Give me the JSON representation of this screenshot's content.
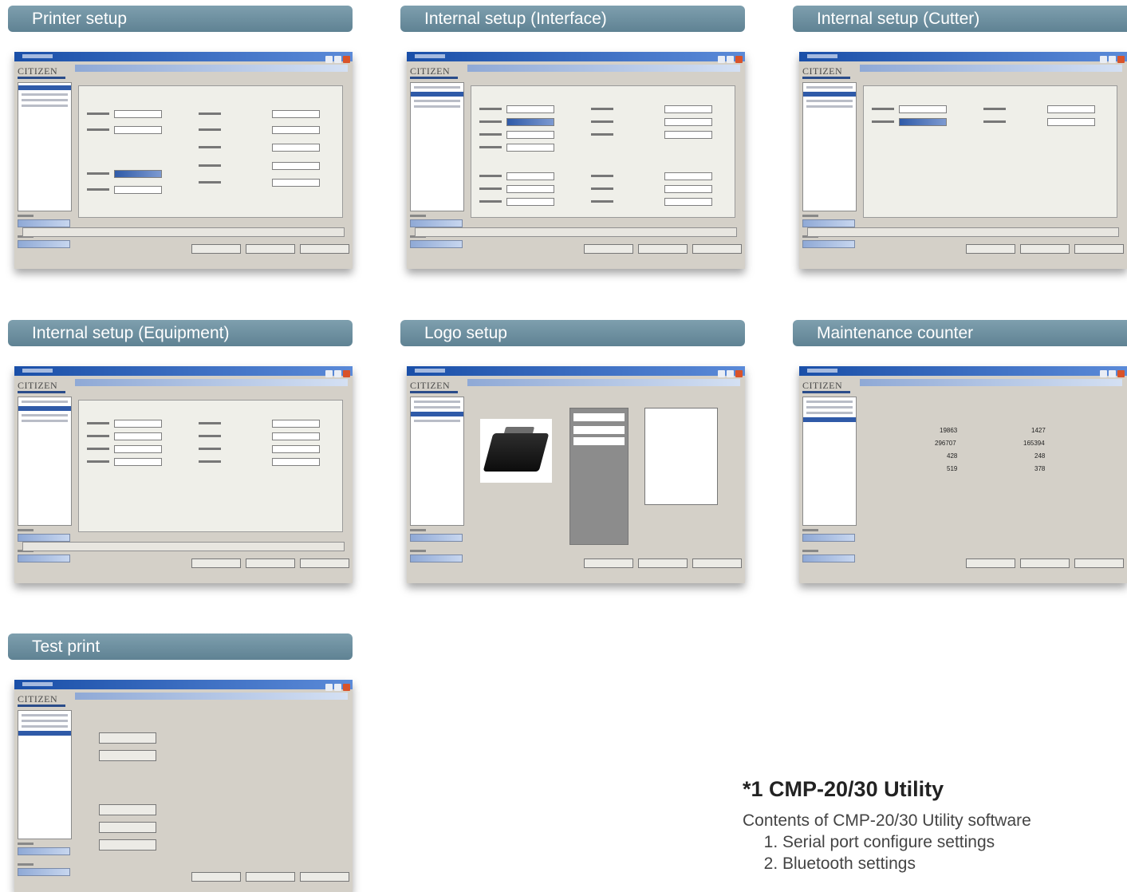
{
  "panels": [
    {
      "title": "Printer setup"
    },
    {
      "title": "Internal setup (Interface)"
    },
    {
      "title": "Internal setup (Cutter)"
    },
    {
      "title": "Internal setup (Equipment)"
    },
    {
      "title": "Logo setup"
    },
    {
      "title": "Maintenance counter"
    },
    {
      "title": "Test print"
    }
  ],
  "screenshot_logo": "CITIZEN",
  "maintenance": {
    "col1": [
      "19863",
      "296707",
      "428",
      "519"
    ],
    "col2": [
      "1427",
      "165394",
      "248",
      "378"
    ]
  },
  "note": {
    "heading": "*1 CMP-20/30 Utility",
    "subtitle": "Contents of CMP-20/30 Utility software",
    "items": [
      "Serial port configure settings",
      "Bluetooth settings"
    ]
  }
}
